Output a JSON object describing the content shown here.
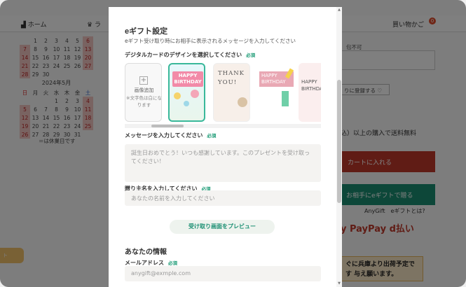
{
  "background": {
    "nav": {
      "home": "ホーム",
      "ranking": "ラ",
      "cart": "買い物かご",
      "cart_count": "0"
    },
    "calendar": {
      "april_rows": [
        [
          "",
          "1",
          "2",
          "3",
          "4",
          "5",
          "6"
        ],
        [
          "7",
          "8",
          "9",
          "10",
          "11",
          "12",
          "13"
        ],
        [
          "14",
          "15",
          "16",
          "17",
          "18",
          "19",
          "20"
        ],
        [
          "21",
          "22",
          "23",
          "24",
          "25",
          "26",
          "27"
        ],
        [
          "28",
          "29",
          "30",
          "",
          "",
          "",
          ""
        ]
      ],
      "may_title": "2024年5月",
      "weekdays": [
        "日",
        "月",
        "火",
        "水",
        "木",
        "金",
        "土"
      ],
      "may_rows": [
        [
          "",
          "",
          "",
          "1",
          "2",
          "3",
          "4"
        ],
        [
          "5",
          "6",
          "7",
          "8",
          "9",
          "10",
          "11"
        ],
        [
          "12",
          "13",
          "14",
          "15",
          "16",
          "17",
          "18"
        ],
        [
          "19",
          "20",
          "21",
          "22",
          "23",
          "24",
          "25"
        ],
        [
          "26",
          "27",
          "28",
          "29",
          "30",
          "31",
          ""
        ]
      ],
      "note": "＝は休業日です"
    },
    "right": {
      "nowrap": "包不可",
      "favorite": "りに登録する ♡",
      "free_shipping": "込）以上の購入で送料無料",
      "cart_button": "カートに入れる",
      "gift_button": "お相手にeギフトで贈る",
      "anygift": "AnyGift　eギフトとは?",
      "payment": "y  PayPay  d払い",
      "ship_notice": "ぐに兵庫より出荷予定です 与え願います。",
      "left_tab": "ト"
    }
  },
  "modal": {
    "title": "eギフト設定",
    "subtitle": "eギフト受け取り時にお相手に表示されるメッセージを入力してください",
    "design_label": "デジタルカードのデザインを選択してください",
    "required": "必須",
    "cards": {
      "upload_title": "画像追加",
      "upload_note": "※文字色は白になります",
      "bday_text": "HAPPY BIRTHDAY",
      "thanks_text": "THANK YOU!",
      "bday2_text": "HAPPY BIRTHDAY",
      "bday3_text": "HAPPY BIRTHDA"
    },
    "message_label": "メッセージを入力してください",
    "message_placeholder": "誕生日おめでとう！いつも感謝しています。このプレゼントを受け取ってください！",
    "sender_label": "贈り主名を入力してください",
    "sender_placeholder": "あなたの名前を入力してください",
    "preview_button": "受け取り画面をプレビュー",
    "info_title": "あなたの情報",
    "email_label": "メールアドレス",
    "email_placeholder": "anygift@exmple.com"
  }
}
